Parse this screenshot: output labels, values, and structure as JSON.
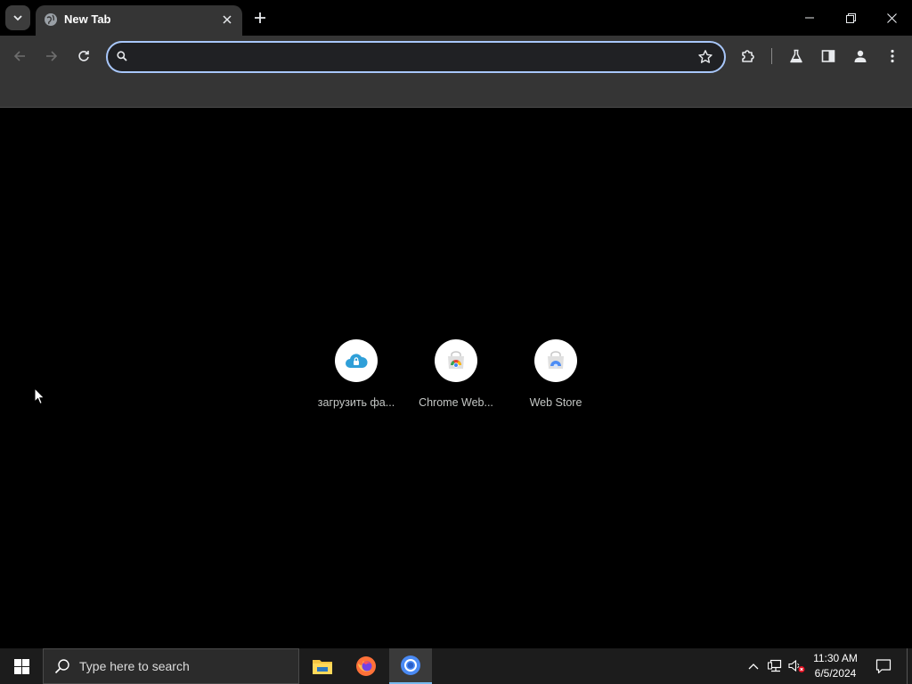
{
  "browser": {
    "tab": {
      "title": "New Tab"
    },
    "omnibox": {
      "value": "",
      "placeholder": ""
    }
  },
  "shortcuts": [
    {
      "label": "загрузить фа...",
      "icon": "cloud-lock-icon"
    },
    {
      "label": "Chrome Web...",
      "icon": "chrome-web-store-icon"
    },
    {
      "label": "Web Store",
      "icon": "web-store-icon"
    }
  ],
  "taskbar": {
    "search_placeholder": "Type here to search",
    "clock": {
      "time": "11:30 AM",
      "date": "6/5/2024"
    }
  },
  "colors": {
    "accent": "#a8c7fa",
    "taskbar_active": "#76b9ed",
    "tab_bg": "#353535"
  }
}
